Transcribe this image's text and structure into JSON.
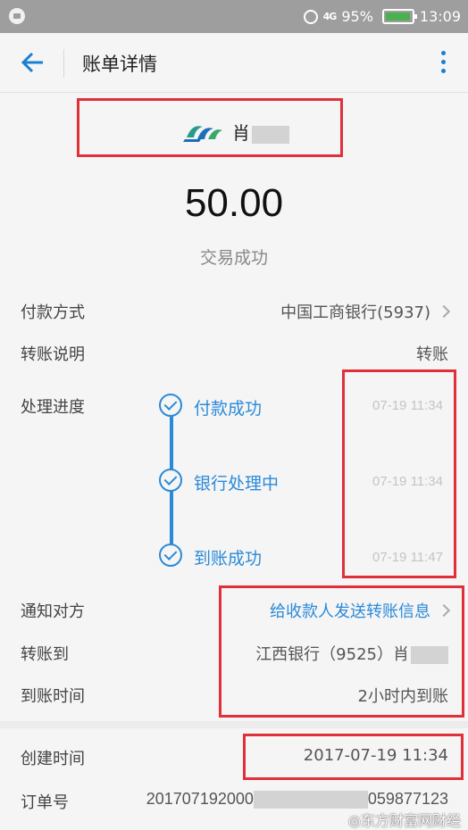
{
  "status_bar": {
    "battery": "95%",
    "time": "13:09",
    "battery_level": 0.95,
    "signal_label": "4G"
  },
  "header": {
    "title": "账单详情"
  },
  "payee": {
    "name_visible": "肖"
  },
  "amount": "50.00",
  "status": "交易成功",
  "details": {
    "payment_method_label": "付款方式",
    "payment_method_value": "中国工商银行(5937)",
    "transfer_note_label": "转账说明",
    "transfer_note_value": "转账",
    "progress_label": "处理进度",
    "steps": [
      {
        "label": "付款成功",
        "time": "07-19 11:34"
      },
      {
        "label": "银行处理中",
        "time": "07-19 11:34"
      },
      {
        "label": "到账成功",
        "time": "07-19 11:47"
      }
    ],
    "notify_label": "通知对方",
    "notify_value": "给收款人发送转账信息",
    "transfer_to_label": "转账到",
    "transfer_to_value": "江西银行（9525）肖",
    "arrival_label": "到账时间",
    "arrival_value": "2小时内到账"
  },
  "meta": {
    "created_label": "创建时间",
    "created_value": "2017-07-19 11:34",
    "order_label": "订单号",
    "order_prefix": "201707192000",
    "order_suffix": "059877123"
  },
  "watermark": "◎东方财富网财经",
  "colors": {
    "accent": "#2b8ad8",
    "highlight_box": "#e0303a",
    "battery": "#4caf50"
  }
}
